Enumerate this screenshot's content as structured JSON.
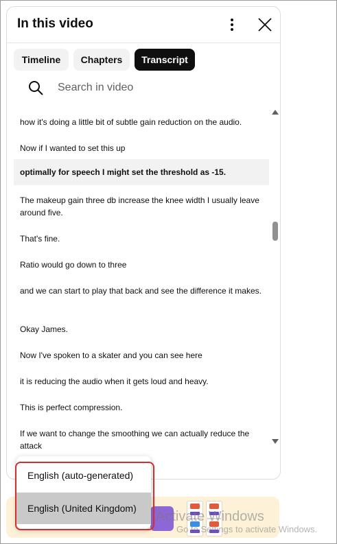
{
  "panel": {
    "title": "In this video"
  },
  "tabs": [
    {
      "label": "Timeline",
      "active": false
    },
    {
      "label": "Chapters",
      "active": false
    },
    {
      "label": "Transcript",
      "active": true
    }
  ],
  "search": {
    "placeholder": "Search in video",
    "value": ""
  },
  "transcript": {
    "segments": [
      {
        "text": "how it's doing a little bit of subtle gain reduction on the audio."
      },
      {
        "text": "Now if I wanted to set this up"
      },
      {
        "text": "optimally for speech I might set the threshold as -15.",
        "highlighted": true
      },
      {
        "text": "The makeup gain three db increase the knee width I usually leave around five."
      },
      {
        "text": "That's fine."
      },
      {
        "text": "Ratio would go down to three"
      },
      {
        "text": "and we can start to play that back and see the difference it makes."
      },
      {
        "text": "Okay James."
      },
      {
        "text": "Now I've spoken to a skater and you can see here"
      },
      {
        "text": "it is reducing the audio when it gets loud and heavy."
      },
      {
        "text": "This is perfect compression."
      },
      {
        "text": "If we want to change the smoothing we can actually reduce the attack"
      }
    ]
  },
  "language_menu": {
    "options": [
      {
        "label": "English (auto-generated)",
        "selected": false
      },
      {
        "label": "English (United Kingdom)",
        "selected": true
      }
    ]
  },
  "watermark": {
    "title": "Activate Windows",
    "subtitle": "Go to Settings to activate Windows."
  },
  "icons": {
    "more": "more-vert-icon",
    "close": "close-icon",
    "search": "search-icon",
    "scroll_up": "scroll-up-arrow-icon",
    "scroll_down": "scroll-down-arrow-icon"
  },
  "colors": {
    "active_tab_bg": "#0f0f0f",
    "tab_bg": "#f2f2f2",
    "highlight_row_bg": "#f2f2f2",
    "selected_option_bg": "#c9c9c9",
    "annotation_border": "#d42d2d",
    "promo_bg": "#fdf1d8"
  }
}
